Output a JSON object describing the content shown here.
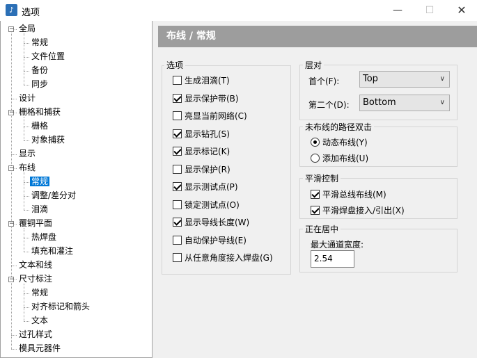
{
  "window": {
    "title": "选项",
    "app_icon": "music-note-app-icon",
    "controls": [
      "minimize-icon",
      "maximize-icon",
      "close-icon"
    ]
  },
  "tree": {
    "items": [
      {
        "label": "全局",
        "level": 0,
        "expander": "minus"
      },
      {
        "label": "常规",
        "level": 1
      },
      {
        "label": "文件位置",
        "level": 1
      },
      {
        "label": "备份",
        "level": 1
      },
      {
        "label": "同步",
        "level": 1
      },
      {
        "label": "设计",
        "level": 0
      },
      {
        "label": "栅格和捕获",
        "level": 0,
        "expander": "minus"
      },
      {
        "label": "栅格",
        "level": 1
      },
      {
        "label": "对象捕获",
        "level": 1
      },
      {
        "label": "显示",
        "level": 0
      },
      {
        "label": "布线",
        "level": 0,
        "expander": "minus"
      },
      {
        "label": "常规",
        "level": 1,
        "selected": true
      },
      {
        "label": "调整/差分对",
        "level": 1
      },
      {
        "label": "泪滴",
        "level": 1
      },
      {
        "label": "覆铜平面",
        "level": 0,
        "expander": "minus"
      },
      {
        "label": "热焊盘",
        "level": 1
      },
      {
        "label": "填充和灌注",
        "level": 1
      },
      {
        "label": "文本和线",
        "level": 0
      },
      {
        "label": "尺寸标注",
        "level": 0,
        "expander": "minus"
      },
      {
        "label": "常规",
        "level": 1
      },
      {
        "label": "对齐标记和箭头",
        "level": 1
      },
      {
        "label": "文本",
        "level": 1
      },
      {
        "label": "过孔样式",
        "level": 0
      },
      {
        "label": "模具元器件",
        "level": 0
      }
    ]
  },
  "panel": {
    "header": "布线 / 常规",
    "options_group": {
      "title": "选项",
      "items": [
        {
          "label": "生成泪滴(T)",
          "checked": false
        },
        {
          "label": "显示保护带(B)",
          "checked": true
        },
        {
          "label": "亮显当前网络(C)",
          "checked": false
        },
        {
          "label": "显示钻孔(S)",
          "checked": true
        },
        {
          "label": "显示标记(K)",
          "checked": true
        },
        {
          "label": "显示保护(R)",
          "checked": false
        },
        {
          "label": "显示测试点(P)",
          "checked": true
        },
        {
          "label": "锁定测试点(O)",
          "checked": false
        },
        {
          "label": "显示导线长度(W)",
          "checked": true
        },
        {
          "label": "自动保护导线(E)",
          "checked": false
        },
        {
          "label": "从任意角度接入焊盘(G)",
          "checked": false
        }
      ]
    },
    "layers_group": {
      "title": "层对",
      "first_label": "首个(F):",
      "first_value": "Top",
      "second_label": "第二个(D):",
      "second_value": "Bottom"
    },
    "unrouted_group": {
      "title": "未布线的路径双击",
      "options": [
        {
          "label": "动态布线(Y)",
          "selected": true
        },
        {
          "label": "添加布线(U)",
          "selected": false
        }
      ]
    },
    "smooth_group": {
      "title": "平滑控制",
      "items": [
        {
          "label": "平滑总线布线(M)",
          "checked": true
        },
        {
          "label": "平滑焊盘接入/引出(X)",
          "checked": true
        }
      ]
    },
    "centering_group": {
      "title": "正在居中",
      "max_width_label": "最大通道宽度:",
      "max_width_value": "2.54"
    }
  }
}
